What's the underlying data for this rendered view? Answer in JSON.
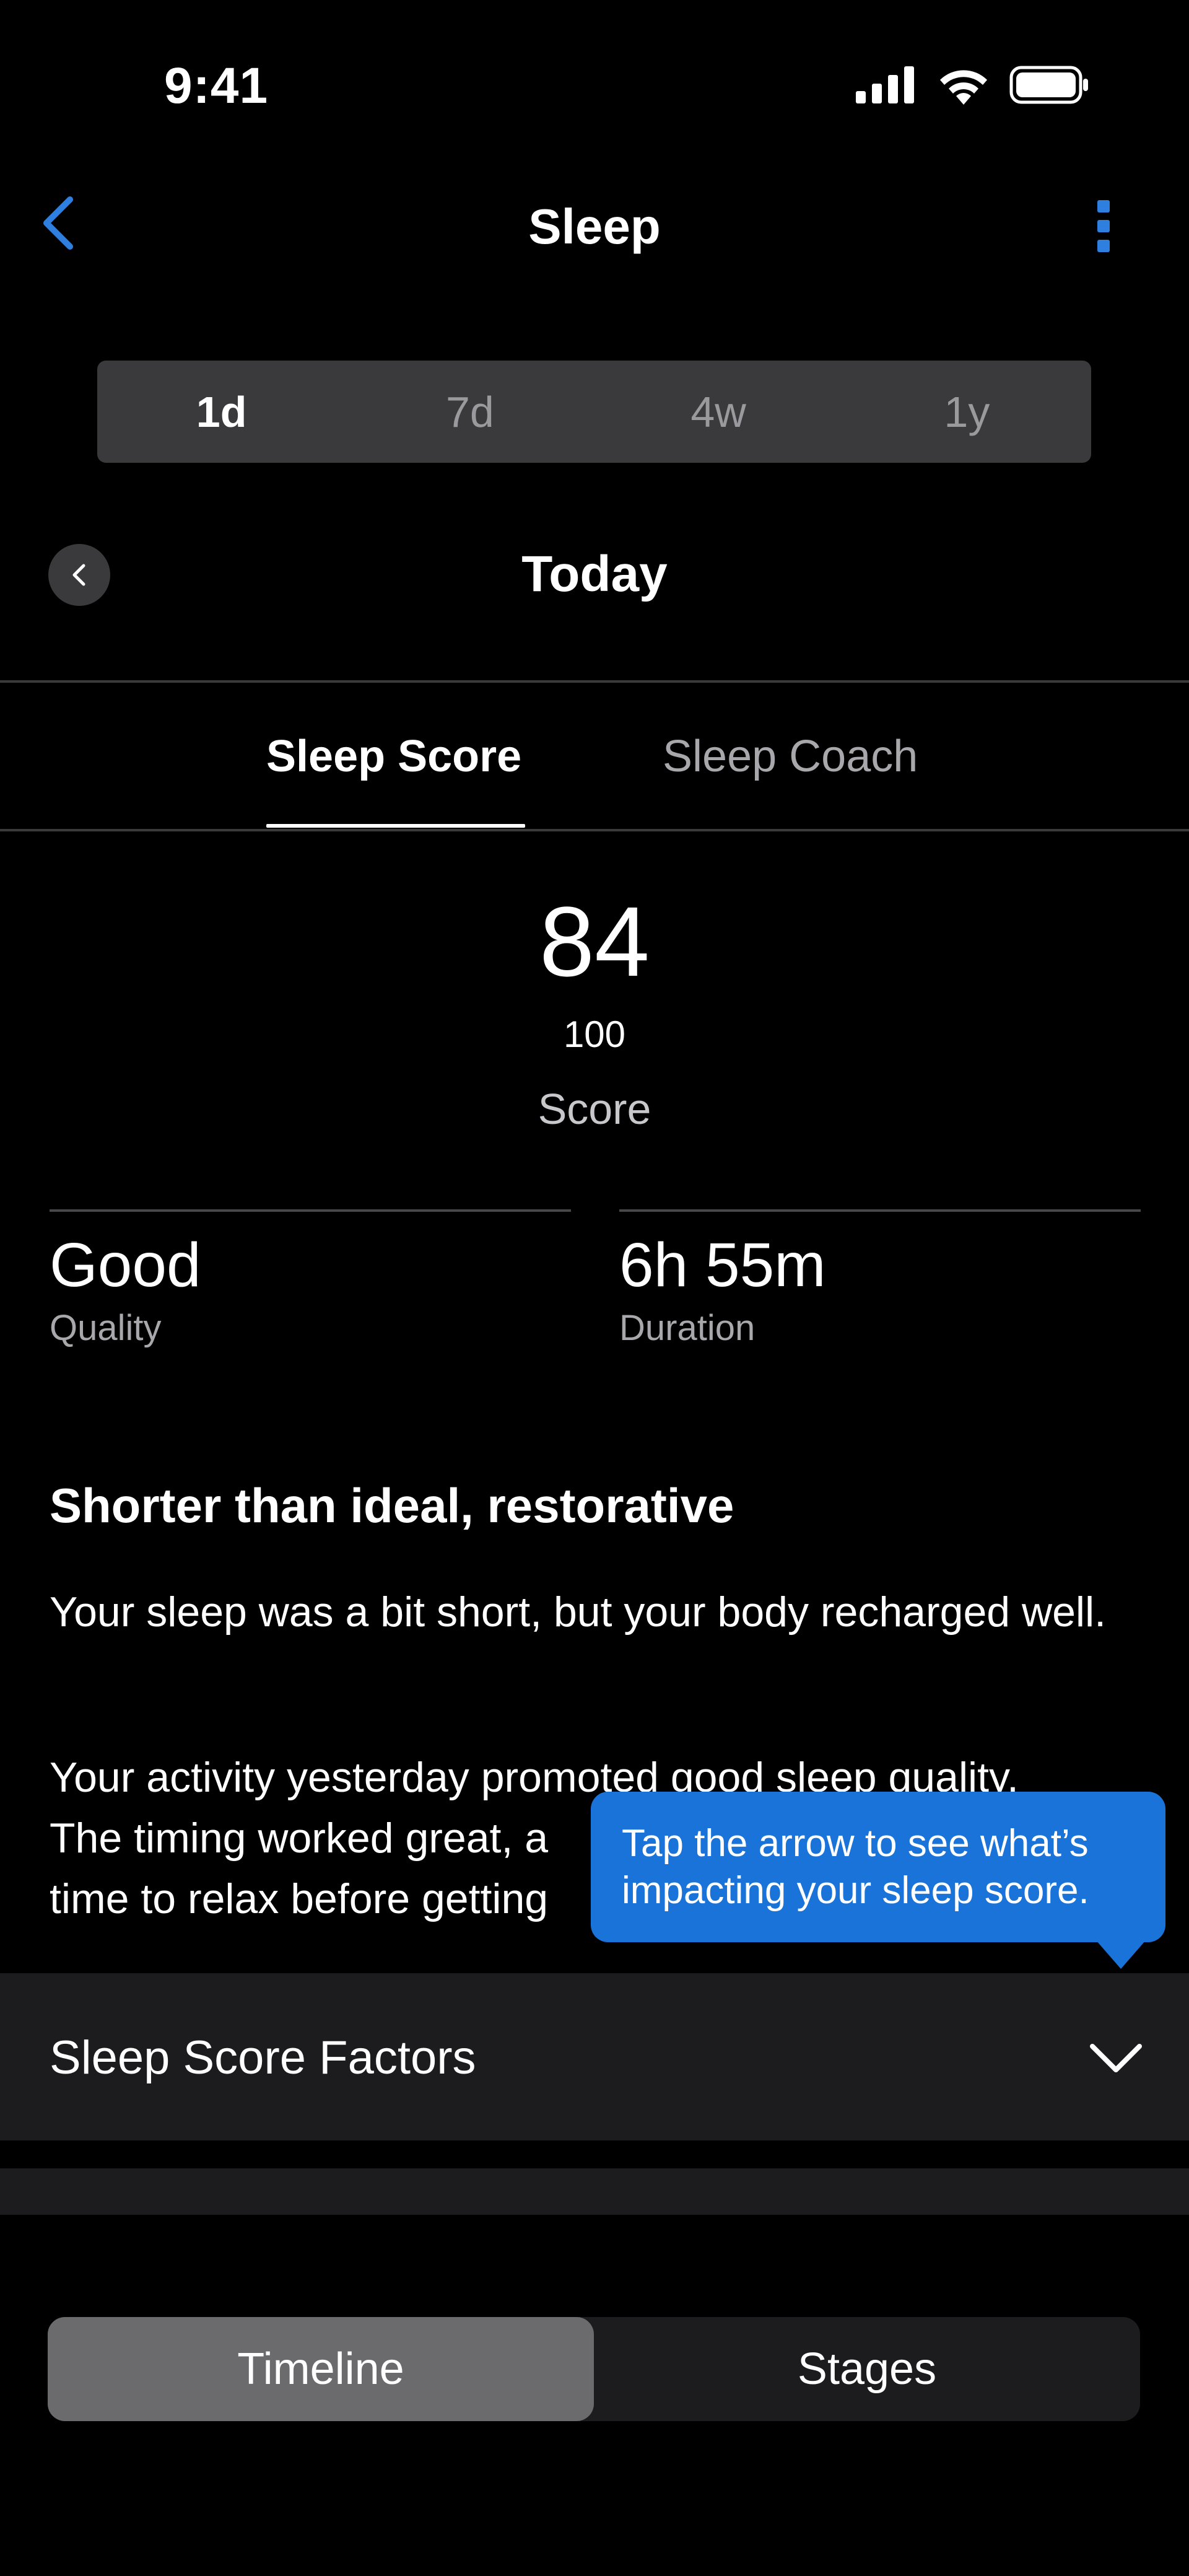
{
  "status_bar": {
    "time": "9:41",
    "icons": [
      "cellular-signal-icon",
      "wifi-icon",
      "battery-icon"
    ]
  },
  "header": {
    "title": "Sleep",
    "back_icon": "chevron-left-icon",
    "more_icon": "more-vertical-icon"
  },
  "range_options": [
    {
      "label": "1d",
      "selected": true
    },
    {
      "label": "7d",
      "selected": false
    },
    {
      "label": "4w",
      "selected": false
    },
    {
      "label": "1y",
      "selected": false
    }
  ],
  "date_nav": {
    "title": "Today",
    "prev_icon": "chevron-left-icon"
  },
  "tabs": [
    {
      "label": "Sleep Score",
      "selected": true
    },
    {
      "label": "Sleep Coach",
      "selected": false
    }
  ],
  "score": {
    "value": "84",
    "max": "100",
    "label": "Score"
  },
  "stats": {
    "quality": {
      "value": "Good",
      "label": "Quality"
    },
    "duration": {
      "value": "6h 55m",
      "label": "Duration"
    }
  },
  "insight": {
    "title": "Shorter than ideal, restorative",
    "para1": "Your sleep was a bit short, but your body recharged well.",
    "para2_line1": "Your activity yesterday promoted good sleep quality.",
    "para2_line2": "The timing worked great, a",
    "para2_line3": "time to relax before getting"
  },
  "factors": {
    "label": "Sleep Score Factors",
    "chevron_icon": "chevron-down-icon"
  },
  "tooltip": {
    "text": "Tap the arrow to see what’s impacting your sleep score."
  },
  "view_toggle": [
    {
      "label": "Timeline",
      "selected": true
    },
    {
      "label": "Stages",
      "selected": false
    }
  ],
  "colors": {
    "accent": "#2e7fe0",
    "tooltip_bg": "#1a73d9",
    "background": "#000000",
    "surface": "#1c1c1e",
    "control_bg": "#3a3a3c"
  }
}
